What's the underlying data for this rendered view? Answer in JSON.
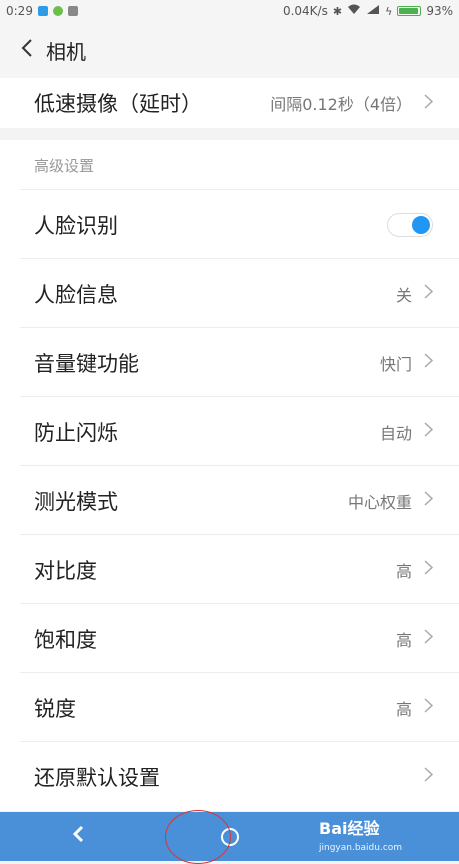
{
  "status_bar": {
    "time": "0:29",
    "network_speed": "0.04K/s",
    "battery_percent": "93%",
    "battery_level": 0.93,
    "icons": [
      "notification-icon",
      "android-icon",
      "message-icon",
      "bluetooth-icon",
      "wifi-icon",
      "signal-icon",
      "charging-icon"
    ]
  },
  "header": {
    "title": "相机",
    "back_icon": "chevron-left-icon"
  },
  "top_row": {
    "label": "低速摄像（延时）",
    "value": "间隔0.12秒（4倍）"
  },
  "advanced": {
    "section_title": "高级设置",
    "items": [
      {
        "label": "人脸识别",
        "type": "toggle",
        "on": true
      },
      {
        "label": "人脸信息",
        "value": "关"
      },
      {
        "label": "音量键功能",
        "value": "快门"
      },
      {
        "label": "防止闪烁",
        "value": "自动"
      },
      {
        "label": "测光模式",
        "value": "中心权重"
      },
      {
        "label": "对比度",
        "value": "高"
      },
      {
        "label": "饱和度",
        "value": "高"
      },
      {
        "label": "锐度",
        "value": "高"
      },
      {
        "label": "还原默认设置",
        "value": ""
      }
    ]
  },
  "nav_bar": {
    "back_icon": "back-arrow-icon",
    "home_icon": "home-circle-icon",
    "watermark": "Bai经验",
    "watermark_sub": "jingyan.baidu.com"
  },
  "colors": {
    "accent": "#2196f3",
    "nav_bar": "#4a90d9",
    "battery": "#4caf50",
    "annotation": "#dd3333"
  }
}
